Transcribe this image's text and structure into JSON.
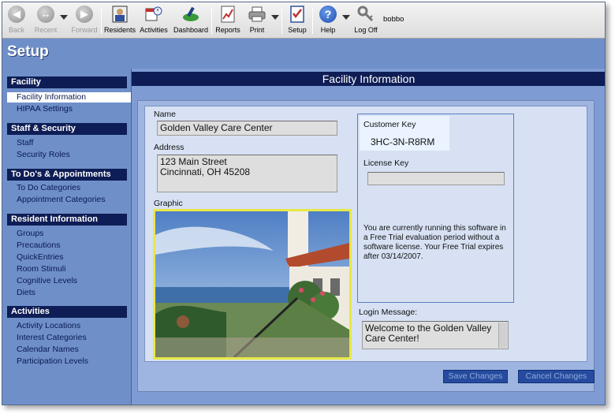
{
  "toolbar": {
    "back": "Back",
    "recent": "Recent",
    "forward": "Forward",
    "residents": "Residents",
    "activities": "Activities",
    "dashboard": "Dashboard",
    "reports": "Reports",
    "print": "Print",
    "setup": "Setup",
    "help": "Help",
    "logoff": "Log Off",
    "username": "bobbo"
  },
  "header": {
    "title": "Setup"
  },
  "sidebar": {
    "sections": [
      {
        "title": "Facility",
        "items": [
          "Facility Information",
          "HIPAA Settings"
        ]
      },
      {
        "title": "Staff & Security",
        "items": [
          "Staff",
          "Security Roles"
        ]
      },
      {
        "title": "To Do's & Appointments",
        "items": [
          "To Do Categories",
          "Appointment Categories"
        ]
      },
      {
        "title": "Resident Information",
        "items": [
          "Groups",
          "Precautions",
          "QuickEntries",
          "Room Stimuli",
          "Cognitive Levels",
          "Diets"
        ]
      },
      {
        "title": "Activities",
        "items": [
          "Activity Locations",
          "Interest Categories",
          "Calendar Names",
          "Participation Levels"
        ]
      }
    ],
    "active_item": "Facility Information"
  },
  "main": {
    "title": "Facility Information",
    "name_label": "Name",
    "name_value": "Golden Valley Care Center",
    "address_label": "Address",
    "address_line1": "123 Main Street",
    "address_line2": "Cincinnati, OH 45208",
    "graphic_label": "Graphic",
    "customer_key_label": "Customer Key",
    "customer_key_value": "3HC-3N-R8RM",
    "license_key_label": "License Key",
    "license_key_value": "",
    "trial_message": "You are currently running this software in a Free Trial evaluation period without a software license. Your Free Trial expires after 03/14/2007.",
    "login_message_label": "Login Message:",
    "login_message_value": "Welcome to the Golden Valley Care Center!",
    "save_button": "Save Changes",
    "cancel_button": "Cancel Changes"
  },
  "colors": {
    "sidebar_header": "#0e1d55",
    "window_bg": "#6f8fc9",
    "graphic_border": "#e8e845",
    "button_bg": "#264b9e"
  }
}
